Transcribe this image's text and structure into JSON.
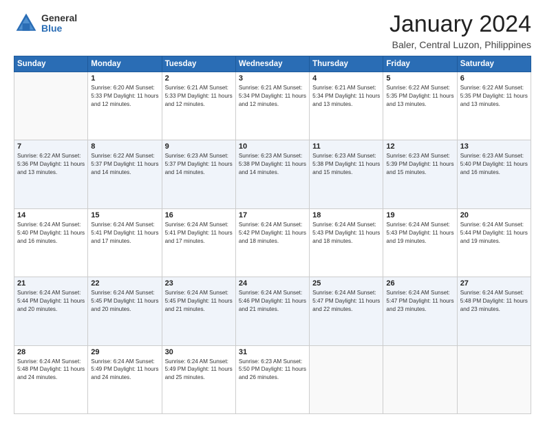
{
  "logo": {
    "general": "General",
    "blue": "Blue"
  },
  "title": {
    "month": "January 2024",
    "location": "Baler, Central Luzon, Philippines"
  },
  "headers": [
    "Sunday",
    "Monday",
    "Tuesday",
    "Wednesday",
    "Thursday",
    "Friday",
    "Saturday"
  ],
  "weeks": [
    [
      {
        "day": "",
        "info": ""
      },
      {
        "day": "1",
        "info": "Sunrise: 6:20 AM\nSunset: 5:33 PM\nDaylight: 11 hours\nand 12 minutes."
      },
      {
        "day": "2",
        "info": "Sunrise: 6:21 AM\nSunset: 5:33 PM\nDaylight: 11 hours\nand 12 minutes."
      },
      {
        "day": "3",
        "info": "Sunrise: 6:21 AM\nSunset: 5:34 PM\nDaylight: 11 hours\nand 12 minutes."
      },
      {
        "day": "4",
        "info": "Sunrise: 6:21 AM\nSunset: 5:34 PM\nDaylight: 11 hours\nand 13 minutes."
      },
      {
        "day": "5",
        "info": "Sunrise: 6:22 AM\nSunset: 5:35 PM\nDaylight: 11 hours\nand 13 minutes."
      },
      {
        "day": "6",
        "info": "Sunrise: 6:22 AM\nSunset: 5:35 PM\nDaylight: 11 hours\nand 13 minutes."
      }
    ],
    [
      {
        "day": "7",
        "info": "Sunrise: 6:22 AM\nSunset: 5:36 PM\nDaylight: 11 hours\nand 13 minutes."
      },
      {
        "day": "8",
        "info": "Sunrise: 6:22 AM\nSunset: 5:37 PM\nDaylight: 11 hours\nand 14 minutes."
      },
      {
        "day": "9",
        "info": "Sunrise: 6:23 AM\nSunset: 5:37 PM\nDaylight: 11 hours\nand 14 minutes."
      },
      {
        "day": "10",
        "info": "Sunrise: 6:23 AM\nSunset: 5:38 PM\nDaylight: 11 hours\nand 14 minutes."
      },
      {
        "day": "11",
        "info": "Sunrise: 6:23 AM\nSunset: 5:38 PM\nDaylight: 11 hours\nand 15 minutes."
      },
      {
        "day": "12",
        "info": "Sunrise: 6:23 AM\nSunset: 5:39 PM\nDaylight: 11 hours\nand 15 minutes."
      },
      {
        "day": "13",
        "info": "Sunrise: 6:23 AM\nSunset: 5:40 PM\nDaylight: 11 hours\nand 16 minutes."
      }
    ],
    [
      {
        "day": "14",
        "info": "Sunrise: 6:24 AM\nSunset: 5:40 PM\nDaylight: 11 hours\nand 16 minutes."
      },
      {
        "day": "15",
        "info": "Sunrise: 6:24 AM\nSunset: 5:41 PM\nDaylight: 11 hours\nand 17 minutes."
      },
      {
        "day": "16",
        "info": "Sunrise: 6:24 AM\nSunset: 5:41 PM\nDaylight: 11 hours\nand 17 minutes."
      },
      {
        "day": "17",
        "info": "Sunrise: 6:24 AM\nSunset: 5:42 PM\nDaylight: 11 hours\nand 18 minutes."
      },
      {
        "day": "18",
        "info": "Sunrise: 6:24 AM\nSunset: 5:43 PM\nDaylight: 11 hours\nand 18 minutes."
      },
      {
        "day": "19",
        "info": "Sunrise: 6:24 AM\nSunset: 5:43 PM\nDaylight: 11 hours\nand 19 minutes."
      },
      {
        "day": "20",
        "info": "Sunrise: 6:24 AM\nSunset: 5:44 PM\nDaylight: 11 hours\nand 19 minutes."
      }
    ],
    [
      {
        "day": "21",
        "info": "Sunrise: 6:24 AM\nSunset: 5:44 PM\nDaylight: 11 hours\nand 20 minutes."
      },
      {
        "day": "22",
        "info": "Sunrise: 6:24 AM\nSunset: 5:45 PM\nDaylight: 11 hours\nand 20 minutes."
      },
      {
        "day": "23",
        "info": "Sunrise: 6:24 AM\nSunset: 5:45 PM\nDaylight: 11 hours\nand 21 minutes."
      },
      {
        "day": "24",
        "info": "Sunrise: 6:24 AM\nSunset: 5:46 PM\nDaylight: 11 hours\nand 21 minutes."
      },
      {
        "day": "25",
        "info": "Sunrise: 6:24 AM\nSunset: 5:47 PM\nDaylight: 11 hours\nand 22 minutes."
      },
      {
        "day": "26",
        "info": "Sunrise: 6:24 AM\nSunset: 5:47 PM\nDaylight: 11 hours\nand 23 minutes."
      },
      {
        "day": "27",
        "info": "Sunrise: 6:24 AM\nSunset: 5:48 PM\nDaylight: 11 hours\nand 23 minutes."
      }
    ],
    [
      {
        "day": "28",
        "info": "Sunrise: 6:24 AM\nSunset: 5:48 PM\nDaylight: 11 hours\nand 24 minutes."
      },
      {
        "day": "29",
        "info": "Sunrise: 6:24 AM\nSunset: 5:49 PM\nDaylight: 11 hours\nand 24 minutes."
      },
      {
        "day": "30",
        "info": "Sunrise: 6:24 AM\nSunset: 5:49 PM\nDaylight: 11 hours\nand 25 minutes."
      },
      {
        "day": "31",
        "info": "Sunrise: 6:23 AM\nSunset: 5:50 PM\nDaylight: 11 hours\nand 26 minutes."
      },
      {
        "day": "",
        "info": ""
      },
      {
        "day": "",
        "info": ""
      },
      {
        "day": "",
        "info": ""
      }
    ]
  ]
}
